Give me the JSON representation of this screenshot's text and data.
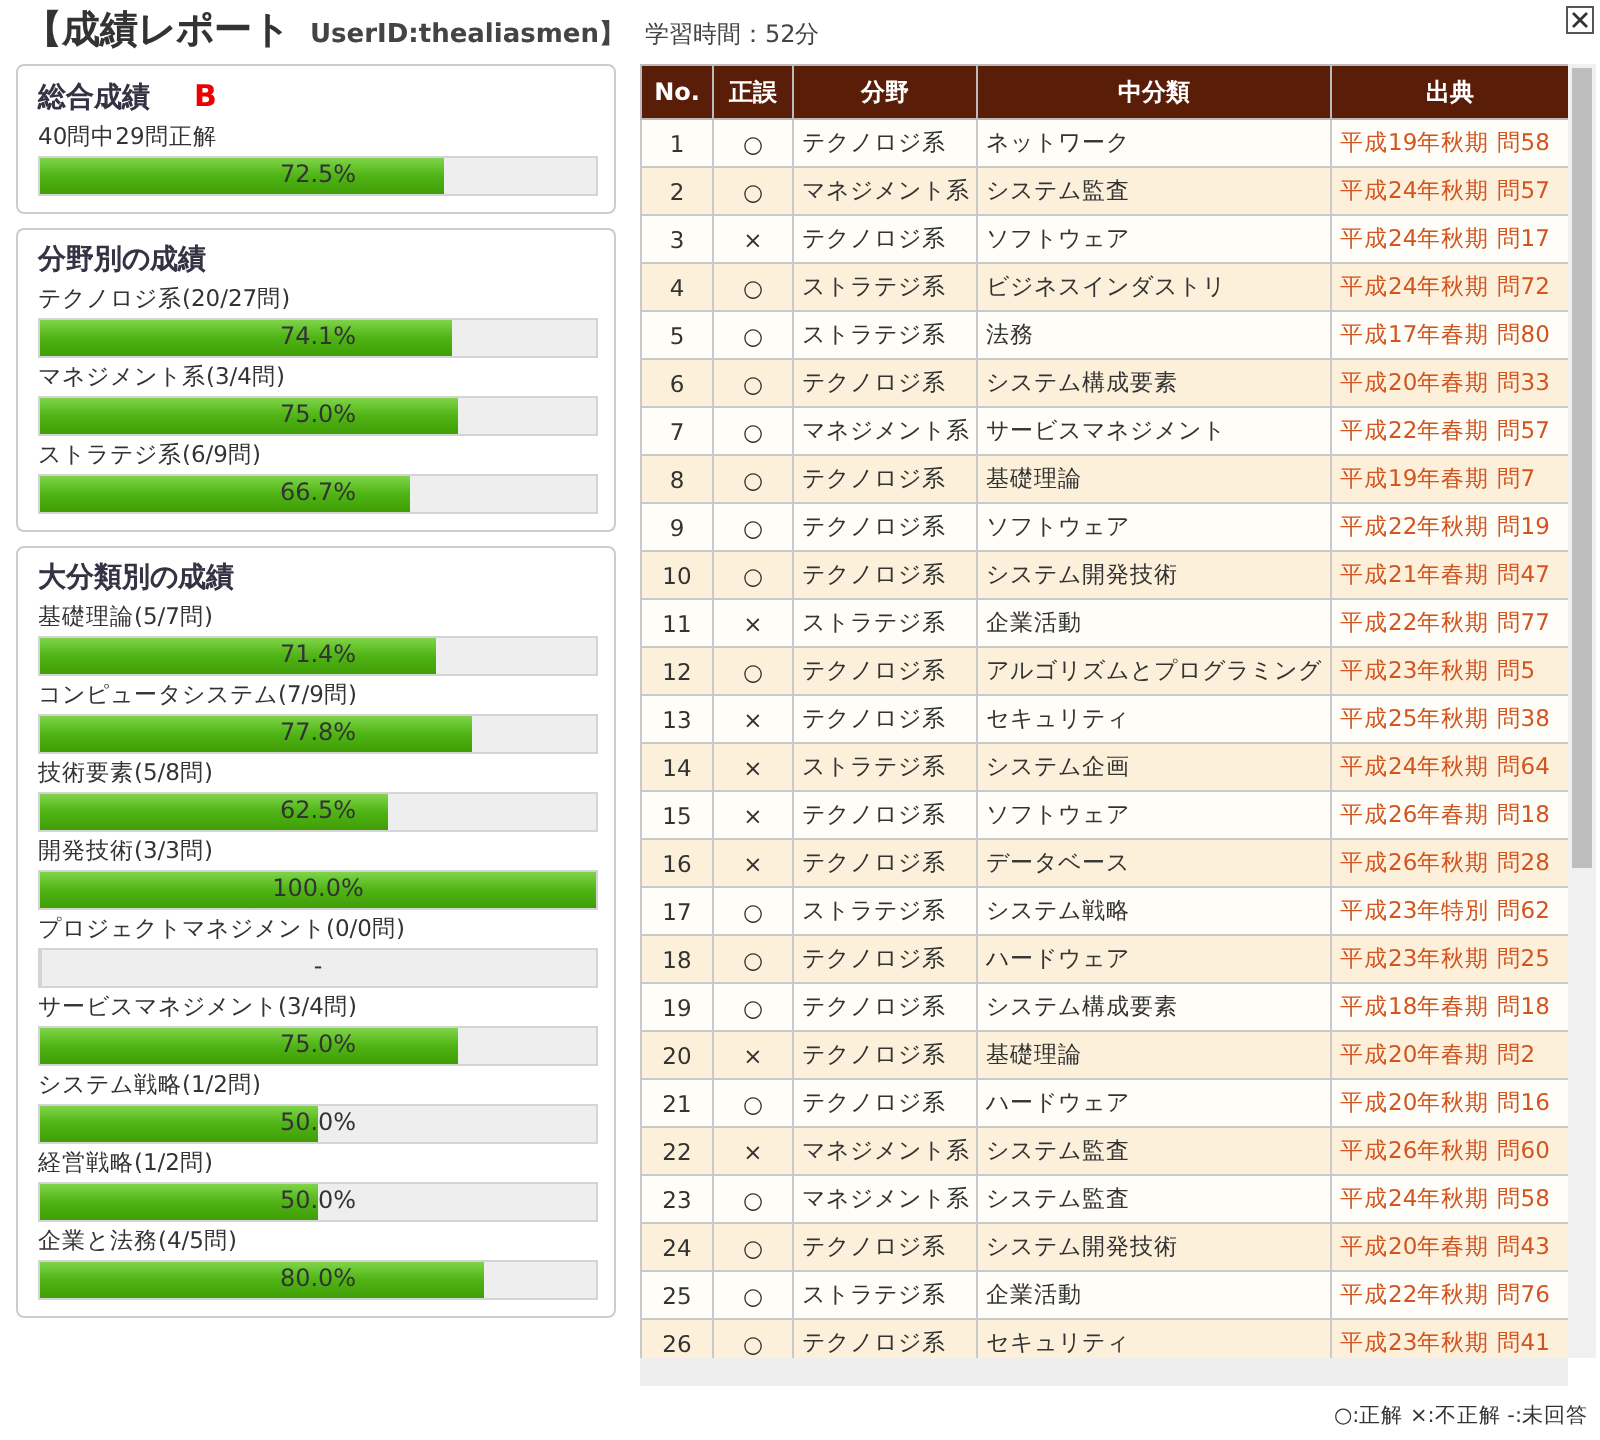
{
  "header": {
    "title": "【成績レポート",
    "user": "UserID:thealiasmen】",
    "study_time": "学習時間：52分"
  },
  "overall": {
    "title": "総合成績",
    "grade": "B",
    "summary": "40問中29問正解",
    "level": 0.725,
    "reading": "72.5%"
  },
  "sections": [
    {
      "title": "分野別の成績",
      "items": [
        {
          "label": "テクノロジ系(20/27問)",
          "level": 0.741,
          "reading": "74.1%"
        },
        {
          "label": "マネジメント系(3/4問)",
          "level": 0.75,
          "reading": "75.0%"
        },
        {
          "label": "ストラテジ系(6/9問)",
          "level": 0.667,
          "reading": "66.7%"
        }
      ]
    },
    {
      "title": "大分類別の成績",
      "items": [
        {
          "label": "基礎理論(5/7問)",
          "level": 0.714,
          "reading": "71.4%"
        },
        {
          "label": "コンピュータシステム(7/9問)",
          "level": 0.778,
          "reading": "77.8%"
        },
        {
          "label": "技術要素(5/8問)",
          "level": 0.625,
          "reading": "62.5%"
        },
        {
          "label": "開発技術(3/3問)",
          "level": 1.0,
          "reading": "100.0%"
        },
        {
          "label": "プロジェクトマネジメント(0/0問)",
          "level": 0,
          "reading": "-"
        },
        {
          "label": "サービスマネジメント(3/4問)",
          "level": 0.75,
          "reading": "75.0%"
        },
        {
          "label": "システム戦略(1/2問)",
          "level": 0.5,
          "reading": "50.0%"
        },
        {
          "label": "経営戦略(1/2問)",
          "level": 0.5,
          "reading": "50.0%"
        },
        {
          "label": "企業と法務(4/5問)",
          "level": 0.8,
          "reading": "80.0%"
        }
      ]
    }
  ],
  "table": {
    "columns": [
      "No.",
      "正誤",
      "分野",
      "中分類",
      "出典"
    ],
    "rows": [
      [
        "1",
        "○",
        "テクノロジ系",
        "ネットワーク",
        "平成19年秋期 問58"
      ],
      [
        "2",
        "○",
        "マネジメント系",
        "システム監査",
        "平成24年秋期 問57"
      ],
      [
        "3",
        "×",
        "テクノロジ系",
        "ソフトウェア",
        "平成24年秋期 問17"
      ],
      [
        "4",
        "○",
        "ストラテジ系",
        "ビジネスインダストリ",
        "平成24年秋期 問72"
      ],
      [
        "5",
        "○",
        "ストラテジ系",
        "法務",
        "平成17年春期 問80"
      ],
      [
        "6",
        "○",
        "テクノロジ系",
        "システム構成要素",
        "平成20年春期 問33"
      ],
      [
        "7",
        "○",
        "マネジメント系",
        "サービスマネジメント",
        "平成22年春期 問57"
      ],
      [
        "8",
        "○",
        "テクノロジ系",
        "基礎理論",
        "平成19年春期 問7"
      ],
      [
        "9",
        "○",
        "テクノロジ系",
        "ソフトウェア",
        "平成22年秋期 問19"
      ],
      [
        "10",
        "○",
        "テクノロジ系",
        "システム開発技術",
        "平成21年春期 問47"
      ],
      [
        "11",
        "×",
        "ストラテジ系",
        "企業活動",
        "平成22年秋期 問77"
      ],
      [
        "12",
        "○",
        "テクノロジ系",
        "アルゴリズムとプログラミング",
        "平成23年秋期 問5"
      ],
      [
        "13",
        "×",
        "テクノロジ系",
        "セキュリティ",
        "平成25年秋期 問38"
      ],
      [
        "14",
        "×",
        "ストラテジ系",
        "システム企画",
        "平成24年秋期 問64"
      ],
      [
        "15",
        "×",
        "テクノロジ系",
        "ソフトウェア",
        "平成26年春期 問18"
      ],
      [
        "16",
        "×",
        "テクノロジ系",
        "データベース",
        "平成26年秋期 問28"
      ],
      [
        "17",
        "○",
        "ストラテジ系",
        "システム戦略",
        "平成23年特別 問62"
      ],
      [
        "18",
        "○",
        "テクノロジ系",
        "ハードウェア",
        "平成23年秋期 問25"
      ],
      [
        "19",
        "○",
        "テクノロジ系",
        "システム構成要素",
        "平成18年春期 問18"
      ],
      [
        "20",
        "×",
        "テクノロジ系",
        "基礎理論",
        "平成20年春期 問2"
      ],
      [
        "21",
        "○",
        "テクノロジ系",
        "ハードウェア",
        "平成20年秋期 問16"
      ],
      [
        "22",
        "×",
        "マネジメント系",
        "システム監査",
        "平成26年秋期 問60"
      ],
      [
        "23",
        "○",
        "マネジメント系",
        "システム監査",
        "平成24年秋期 問58"
      ],
      [
        "24",
        "○",
        "テクノロジ系",
        "システム開発技術",
        "平成20年春期 問43"
      ],
      [
        "25",
        "○",
        "ストラテジ系",
        "企業活動",
        "平成22年秋期 問76"
      ],
      [
        "26",
        "○",
        "テクノロジ系",
        "セキュリティ",
        "平成23年秋期 問41"
      ]
    ]
  },
  "legend": "○:正解 ×:不正解 -:未回答"
}
